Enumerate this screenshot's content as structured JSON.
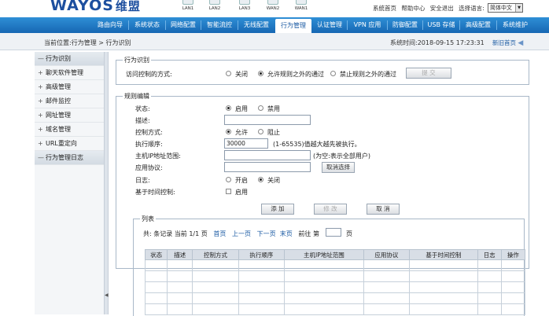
{
  "brand": {
    "logo_text": "WAYOS",
    "logo_cn": "维盟"
  },
  "ports": [
    "LAN1",
    "LAN2",
    "LAN3",
    "WAN2",
    "WAN1"
  ],
  "toplinks": [
    "系统首页",
    "帮助中心",
    "安全退出",
    "选择语言:"
  ],
  "language": {
    "selected": "简体中文"
  },
  "nav": [
    "路由向导",
    "系统状态",
    "网络配置",
    "智能流控",
    "无线配置",
    "行为管理",
    "认证管理",
    "VPN 应用",
    "防御配置",
    "USB 存储",
    "高级配置",
    "系统维护"
  ],
  "nav_active": "行为管理",
  "breadcrumb": "当前位置:行为管理 > 行为识别",
  "system_time": "系统时间:2018-09-15 17:23:31",
  "hometools": {
    "new_home": "新旧首页",
    "back": "◀"
  },
  "sidebar": [
    {
      "pm": "—",
      "label": "行为识别",
      "head": true
    },
    {
      "pm": "+",
      "label": "聊天软件管理"
    },
    {
      "pm": "+",
      "label": "高级管理"
    },
    {
      "pm": "+",
      "label": "邮件监控"
    },
    {
      "pm": "+",
      "label": "网址管理"
    },
    {
      "pm": "+",
      "label": "域名管理"
    },
    {
      "pm": "+",
      "label": "URL重定向"
    },
    {
      "pm": "—",
      "label": "行为管理日志",
      "head": true
    }
  ],
  "access_box": {
    "legend": "行为识别",
    "label": "访问控制的方式:",
    "options": [
      "关闭",
      "允许规则之外的通过",
      "禁止规则之外的通过"
    ],
    "selected_index": 1,
    "submit": "提 交"
  },
  "rule_box": {
    "legend": "规则编辑",
    "status_label": "状态:",
    "status_options": [
      "启用",
      "禁用"
    ],
    "desc_label": "描述:",
    "desc_value": "",
    "ctrl_label": "控制方式:",
    "ctrl_options": [
      "允许",
      "阻止"
    ],
    "order_label": "执行顺序:",
    "order_value": "30000",
    "order_hint": "(1-65535)值越大越先被执行。",
    "ip_label": "主机IP地址范围:",
    "ip_value": "",
    "ip_hint": "(为空:表示全部用户)",
    "proto_label": "应用协议:",
    "proto_value": "",
    "proto_button": "取消选择",
    "log_label": "日志:",
    "log_options": [
      "开启",
      "关闭"
    ],
    "time_label": "基于时间控制:",
    "time_option": "启用",
    "add": "添 加",
    "modify": "修 改",
    "cancel": "取 消"
  },
  "list_box": {
    "legend": "列表",
    "pager": {
      "total": "共: 条记录 当前 1/1 页",
      "first": "首页",
      "prev": "上一页",
      "next": "下一页",
      "last": "末页",
      "goto": "前往 第",
      "page_value": "",
      "page_unit": "页"
    },
    "columns": [
      "状态",
      "描述",
      "控制方式",
      "执行顺序",
      "主机IP地址范围",
      "应用协议",
      "基于时间控制",
      "日志",
      "操作"
    ],
    "empty_rows": 5
  }
}
